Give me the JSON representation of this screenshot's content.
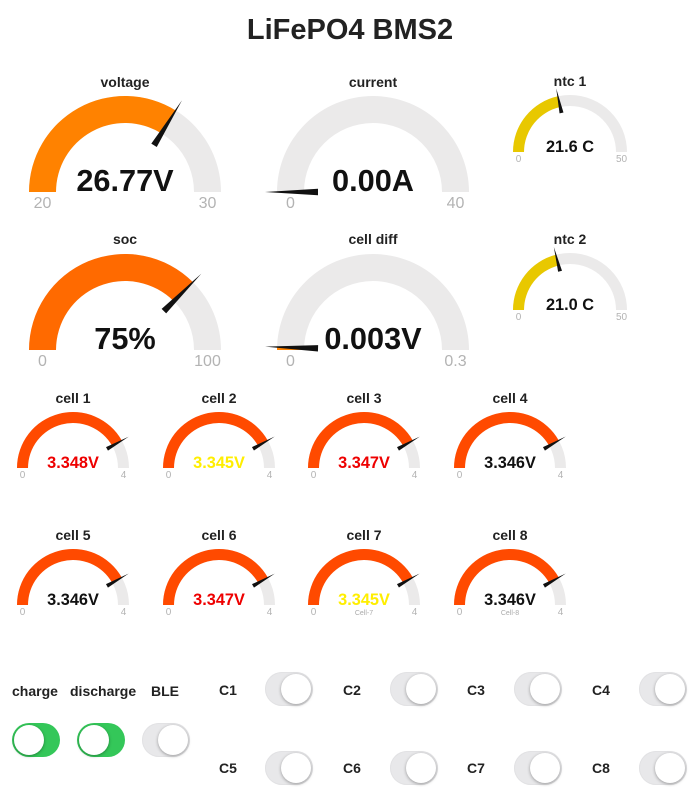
{
  "title": "LiFePO4 BMS2",
  "colors": {
    "track": "#ebeaea",
    "needle": "#111111",
    "toggle_on": "#34c759",
    "toggle_off": "#e8e8ea"
  },
  "gauges": {
    "voltage": {
      "label": "voltage",
      "value": 26.77,
      "display": "26.77V",
      "min": 0.0,
      "max": 30.0,
      "min_label": "20",
      "max_label": "30",
      "color": "#ff8200",
      "text_color": "#111111",
      "caption": ""
    },
    "current": {
      "label": "current",
      "value": 0.0,
      "display": "0.00A",
      "min": 0.0,
      "max": 40.0,
      "min_label": "0",
      "max_label": "40",
      "color": "#ff8200",
      "text_color": "#111111",
      "caption": ""
    },
    "ntc1": {
      "label": "ntc 1",
      "value": 21.6,
      "display": "21.6 C",
      "min": 0.0,
      "max": 50.0,
      "min_label": "0",
      "max_label": "50",
      "color": "#e8c800",
      "text_color": "#111111",
      "caption": ""
    },
    "soc": {
      "label": "soc",
      "value": 75,
      "display": "75%",
      "min": 0,
      "max": 100,
      "min_label": "0",
      "max_label": "100",
      "color": "#ff6a00",
      "text_color": "#111111",
      "caption": ""
    },
    "celldiff": {
      "label": "cell diff",
      "value": 0.003,
      "display": "0.003V",
      "min": 0.0,
      "max": 0.3,
      "min_label": "0",
      "max_label": "0.3",
      "color": "#ff8200",
      "text_color": "#111111",
      "caption": ""
    },
    "ntc2": {
      "label": "ntc 2",
      "value": 21.0,
      "display": "21.0 C",
      "min": 0.0,
      "max": 50.0,
      "min_label": "0",
      "max_label": "50",
      "color": "#e8c800",
      "text_color": "#111111",
      "caption": ""
    },
    "cell1": {
      "label": "cell 1",
      "value": 3.348,
      "display": "3.348V",
      "min": 0.0,
      "max": 4.0,
      "min_label": "0",
      "max_label": "4",
      "color": "#ff4a00",
      "text_color": "#ee0000",
      "caption": ""
    },
    "cell2": {
      "label": "cell 2",
      "value": 3.345,
      "display": "3.345V",
      "min": 0.0,
      "max": 4.0,
      "min_label": "0",
      "max_label": "4",
      "color": "#ff4a00",
      "text_color": "#ffee00",
      "caption": ""
    },
    "cell3": {
      "label": "cell 3",
      "value": 3.347,
      "display": "3.347V",
      "min": 0.0,
      "max": 4.0,
      "min_label": "0",
      "max_label": "4",
      "color": "#ff4a00",
      "text_color": "#ee0000",
      "caption": ""
    },
    "cell4": {
      "label": "cell 4",
      "value": 3.346,
      "display": "3.346V",
      "min": 0.0,
      "max": 4.0,
      "min_label": "0",
      "max_label": "4",
      "color": "#ff4a00",
      "text_color": "#111111",
      "caption": ""
    },
    "cell5": {
      "label": "cell 5",
      "value": 3.346,
      "display": "3.346V",
      "min": 0.0,
      "max": 4.0,
      "min_label": "0",
      "max_label": "4",
      "color": "#ff4a00",
      "text_color": "#111111",
      "caption": ""
    },
    "cell6": {
      "label": "cell 6",
      "value": 3.347,
      "display": "3.347V",
      "min": 0.0,
      "max": 4.0,
      "min_label": "0",
      "max_label": "4",
      "color": "#ff4a00",
      "text_color": "#ee0000",
      "caption": ""
    },
    "cell7": {
      "label": "cell 7",
      "value": 3.345,
      "display": "3.345V",
      "min": 0.0,
      "max": 4.0,
      "min_label": "0",
      "max_label": "4",
      "color": "#ff4a00",
      "text_color": "#ffee00",
      "caption": "Cell-7"
    },
    "cell8": {
      "label": "cell 8",
      "value": 3.346,
      "display": "3.346V",
      "min": 0.0,
      "max": 4.0,
      "min_label": "0",
      "max_label": "4",
      "color": "#ff4a00",
      "text_color": "#111111",
      "caption": "Cell-8"
    }
  },
  "switches": {
    "charge": {
      "label": "charge",
      "on": true
    },
    "discharge": {
      "label": "discharge",
      "on": true
    },
    "ble": {
      "label": "BLE",
      "on": false
    }
  },
  "balance": [
    {
      "label": "C1",
      "on": false
    },
    {
      "label": "C2",
      "on": false
    },
    {
      "label": "C3",
      "on": false
    },
    {
      "label": "C4",
      "on": false
    },
    {
      "label": "C5",
      "on": false
    },
    {
      "label": "C6",
      "on": false
    },
    {
      "label": "C7",
      "on": false
    },
    {
      "label": "C8",
      "on": false
    }
  ]
}
